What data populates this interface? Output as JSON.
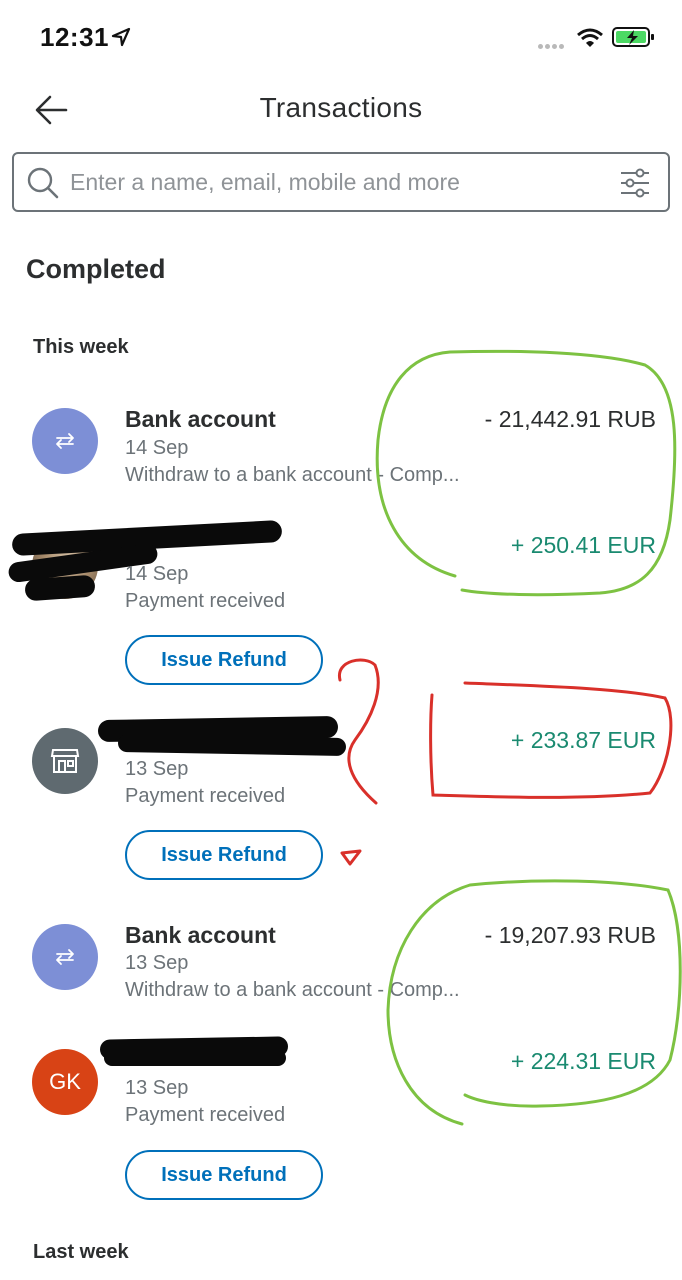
{
  "status_bar": {
    "time": "12:31"
  },
  "header": {
    "title": "Transactions",
    "back_icon": "arrow-left-icon"
  },
  "search": {
    "placeholder": "Enter a name, email, mobile and more",
    "value": ""
  },
  "section": {
    "title": "Completed"
  },
  "groups": {
    "this_week": "This week",
    "last_week": "Last week"
  },
  "transactions": [
    {
      "name": "Bank account",
      "date": "14 Sep",
      "desc": "Withdraw to a bank account - Comp...",
      "amount": "- 21,442.91 RUB",
      "avatar": "bank-transfer-icon"
    },
    {
      "name": "",
      "date": "14 Sep",
      "desc": "Payment received",
      "amount": "+ 250.41 EUR",
      "avatar": "profile-photo",
      "refund_label": "Issue Refund"
    },
    {
      "name": "",
      "date": "13 Sep",
      "desc": "Payment received",
      "amount": "+ 233.87 EUR",
      "avatar": "store-icon",
      "refund_label": "Issue Refund"
    },
    {
      "name": "Bank account",
      "date": "13 Sep",
      "desc": "Withdraw to a bank account - Comp...",
      "amount": "- 19,207.93 RUB",
      "avatar": "bank-transfer-icon"
    },
    {
      "name": "",
      "date": "13 Sep",
      "desc": "Payment received",
      "amount": "+ 224.31 EUR",
      "avatar_initials": "GK",
      "refund_label": "Issue Refund"
    }
  ],
  "colors": {
    "accent": "#0070ba",
    "positive": "#1a8a70",
    "bank_avatar": "#7d8fd6",
    "initials_avatar": "#d84315",
    "annotation_green": "#7dc242",
    "annotation_red": "#d9302a"
  }
}
